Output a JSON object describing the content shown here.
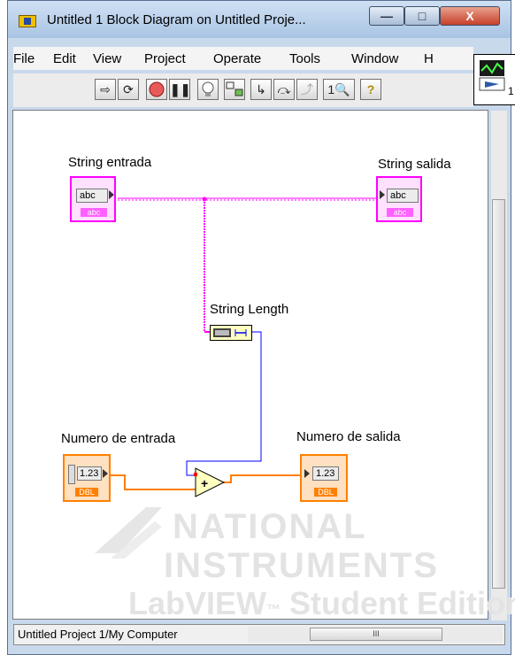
{
  "window": {
    "title": "Untitled 1 Block Diagram on Untitled Proje...",
    "min_glyph": "—",
    "max_glyph": "□",
    "close_glyph": "X"
  },
  "menu": [
    "File",
    "Edit",
    "View",
    "Project",
    "Operate",
    "Tools",
    "Window",
    "H"
  ],
  "toolbar": {
    "buttons": [
      "run-arrow-icon",
      "run-continuously-icon",
      "abort-icon",
      "pause-icon",
      "highlight-bulb-icon",
      "retain-wire-values-icon",
      "step-into-icon",
      "step-over-icon",
      "step-out-icon",
      "clean-up-icon",
      "context-help-icon"
    ],
    "font_size_field": "1"
  },
  "context_help": {
    "number": "1"
  },
  "diagram": {
    "string_in": {
      "label": "String entrada",
      "terminal_text": "abc",
      "type_text": "abc"
    },
    "string_out": {
      "label": "String salida",
      "terminal_text": "abc",
      "type_text": "abc"
    },
    "string_length": {
      "label": "String Length"
    },
    "num_in": {
      "label": "Numero de entrada",
      "terminal_text": "1.23",
      "type_text": "DBL"
    },
    "num_out": {
      "label": "Numero de salida",
      "terminal_text": "1.23",
      "type_text": "DBL"
    },
    "add": {
      "symbol": "+"
    },
    "colors": {
      "string_wire": "#ff00ff",
      "numeric_int_wire": "#0000ff",
      "numeric_dbl_wire": "#ff8000"
    }
  },
  "watermark": {
    "line1": "NATIONAL",
    "line2": "INSTRUMENTS",
    "line3": "LabVIEW",
    "line3_tm": "™",
    "line3_rest": "Student Edition"
  },
  "status": {
    "path": "Untitled Project 1/My Computer",
    "scroll_glyph": "III"
  }
}
